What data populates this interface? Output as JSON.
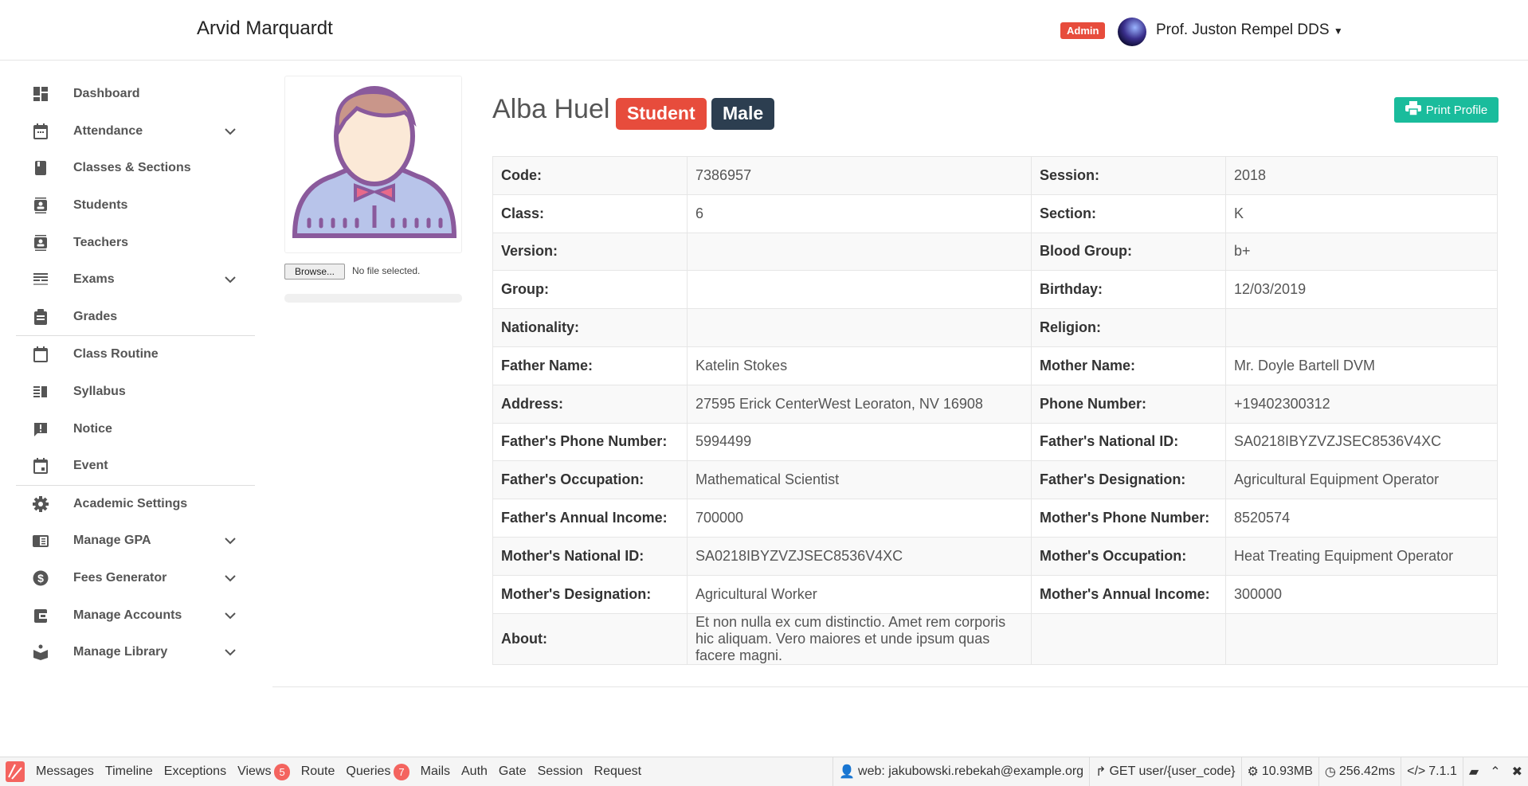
{
  "header": {
    "title": "Arvid Marquardt",
    "role_badge": "Admin",
    "user_name": "Prof. Juston Rempel DDS"
  },
  "sidebar": {
    "items": [
      {
        "label": "Dashboard",
        "icon": "dashboard-icon",
        "dropdown": false
      },
      {
        "label": "Attendance",
        "icon": "calendar-icon",
        "dropdown": true
      },
      {
        "label": "Classes & Sections",
        "icon": "book-icon",
        "dropdown": false
      },
      {
        "label": "Students",
        "icon": "contact-card-icon",
        "dropdown": false
      },
      {
        "label": "Teachers",
        "icon": "contact-card-icon",
        "dropdown": false
      },
      {
        "label": "Exams",
        "icon": "list-icon",
        "dropdown": true
      },
      {
        "label": "Grades",
        "icon": "clipboard-icon",
        "dropdown": false
      },
      {
        "label": "Class Routine",
        "icon": "calendar-blank-icon",
        "dropdown": false,
        "divider_before": true
      },
      {
        "label": "Syllabus",
        "icon": "syllabus-icon",
        "dropdown": false
      },
      {
        "label": "Notice",
        "icon": "alert-message-icon",
        "dropdown": false
      },
      {
        "label": "Event",
        "icon": "event-icon",
        "dropdown": false
      },
      {
        "label": "Academic Settings",
        "icon": "gear-icon",
        "dropdown": false,
        "divider_before": true
      },
      {
        "label": "Manage GPA",
        "icon": "chrome-reader-icon",
        "dropdown": true
      },
      {
        "label": "Fees Generator",
        "icon": "dollar-icon",
        "dropdown": true
      },
      {
        "label": "Manage Accounts",
        "icon": "wallet-icon",
        "dropdown": true
      },
      {
        "label": "Manage Library",
        "icon": "library-icon",
        "dropdown": true
      }
    ]
  },
  "upload": {
    "browse_label": "Browse...",
    "status": "No file selected."
  },
  "profile": {
    "name": "Alba Huel",
    "role": "Student",
    "gender": "Male",
    "print_label": "Print Profile",
    "role_color": "#e74c3c",
    "gender_color": "#2c3e50",
    "print_color": "#1abc9c"
  },
  "details": [
    [
      "Code:",
      "7386957",
      "Session:",
      "2018"
    ],
    [
      "Class:",
      "6",
      "Section:",
      "K"
    ],
    [
      "Version:",
      "",
      "Blood Group:",
      "b+"
    ],
    [
      "Group:",
      "",
      "Birthday:",
      "12/03/2019"
    ],
    [
      "Nationality:",
      "",
      "Religion:",
      ""
    ],
    [
      "Father Name:",
      "Katelin Stokes",
      "Mother Name:",
      "Mr. Doyle Bartell DVM"
    ],
    [
      "Address:",
      "27595 Erick CenterWest Leoraton, NV 16908",
      "Phone Number:",
      "+19402300312"
    ],
    [
      "Father's Phone Number:",
      "5994499",
      "Father's National ID:",
      "SA0218IBYZVZJSEC8536V4XC"
    ],
    [
      "Father's Occupation:",
      "Mathematical Scientist",
      "Father's Designation:",
      "Agricultural Equipment Operator"
    ],
    [
      "Father's Annual Income:",
      "700000",
      "Mother's Phone Number:",
      "8520574"
    ],
    [
      "Mother's National ID:",
      "SA0218IBYZVZJSEC8536V4XC",
      "Mother's Occupation:",
      "Heat Treating Equipment Operator"
    ],
    [
      "Mother's Designation:",
      "Agricultural Worker",
      "Mother's Annual Income:",
      "300000"
    ],
    [
      "About:",
      "Et non nulla ex cum distinctio. Amet rem corporis hic aliquam. Vero maiores et unde ipsum quas facere magni."
    ]
  ],
  "debugbar": {
    "tabs": [
      {
        "label": "Messages"
      },
      {
        "label": "Timeline"
      },
      {
        "label": "Exceptions"
      },
      {
        "label": "Views",
        "count": "5"
      },
      {
        "label": "Route"
      },
      {
        "label": "Queries",
        "count": "7"
      },
      {
        "label": "Mails"
      },
      {
        "label": "Auth"
      },
      {
        "label": "Gate"
      },
      {
        "label": "Session"
      },
      {
        "label": "Request"
      }
    ],
    "user": "web: jakubowski.rebekah@example.org",
    "route": "GET user/{user_code}",
    "memory": "10.93MB",
    "time": "256.42ms",
    "version": "7.1.1"
  }
}
